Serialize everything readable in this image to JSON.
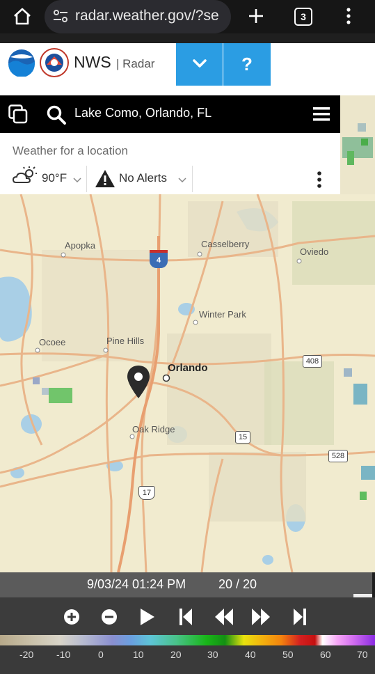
{
  "browser": {
    "url": "radar.weather.gov/?se",
    "tab_count": "3",
    "icons": [
      "home-icon",
      "site-settings-icon",
      "new-tab-icon",
      "tabs-icon",
      "menu-icon"
    ]
  },
  "header": {
    "title": "NWS",
    "subtitle": "| Radar",
    "logos": [
      "noaa-logo",
      "nws-logo"
    ],
    "buttons": [
      "chevron-down-icon",
      "help-icon"
    ],
    "help_label": "?",
    "accent_color": "#2b9de3"
  },
  "search": {
    "location": "Lake Como, Orlando, FL"
  },
  "weather": {
    "heading": "Weather for a location",
    "temperature": "90°F",
    "alerts": "No Alerts"
  },
  "map": {
    "places": {
      "apopka": "Apopka",
      "casselberry": "Casselberry",
      "oviedo": "Oviedo",
      "winter_park": "Winter Park",
      "ocoee": "Ocoee",
      "pine_hills": "Pine Hills",
      "orlando": "Orlando",
      "oak_ridge": "Oak Ridge"
    },
    "shields": {
      "i4": "4",
      "sr408": "408",
      "us15": "15",
      "sr528": "528",
      "us17": "17"
    }
  },
  "timeline": {
    "timestamp": "9/03/24 01:24 PM",
    "frame": "20 / 20"
  },
  "legend": {
    "ticks": [
      "-20",
      "-10",
      "0",
      "10",
      "20",
      "30",
      "40",
      "50",
      "60",
      "70"
    ]
  }
}
